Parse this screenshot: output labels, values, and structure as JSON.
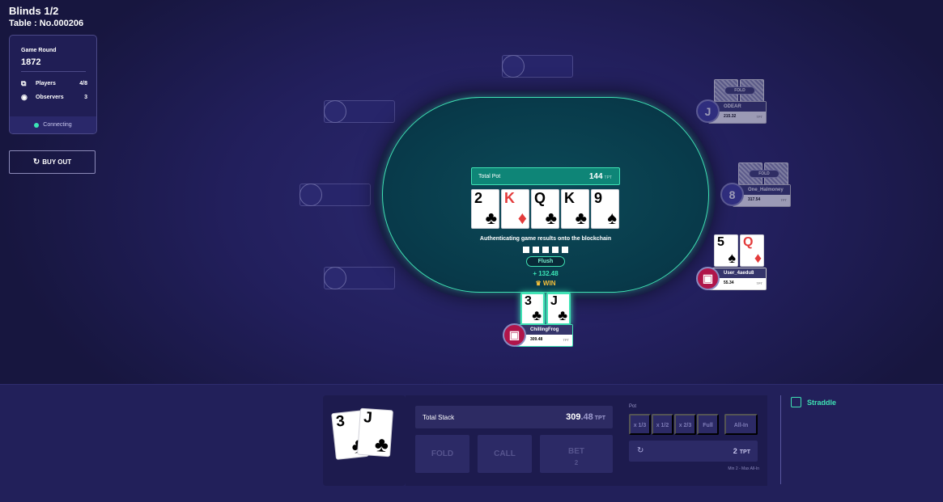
{
  "header": {
    "title": "Blinds 1/2",
    "table": "Table : No.000206"
  },
  "info": {
    "round_label": "Game Round",
    "round_value": "1872",
    "players_label": "Players",
    "players_value": "4/8",
    "observers_label": "Observers",
    "observers_value": "3",
    "status": "Connecting"
  },
  "buyout_label": "BUY OUT",
  "pot": {
    "label": "Total Pot",
    "value": "144",
    "unit": "TPT"
  },
  "community_cards": [
    {
      "rank": "2",
      "suit": "♣",
      "color": "black"
    },
    {
      "rank": "K",
      "suit": "♦",
      "color": "red"
    },
    {
      "rank": "Q",
      "suit": "♣",
      "color": "black"
    },
    {
      "rank": "K",
      "suit": "♣",
      "color": "black"
    },
    {
      "rank": "9",
      "suit": "♠",
      "color": "black"
    }
  ],
  "status_text": "Authenticating game results onto the blockchain",
  "hand_name": "Flush",
  "gain": "+ 132.48",
  "win_label": "WIN",
  "players": {
    "odear": {
      "name": "ODEAR",
      "stack": "215.32",
      "unit": "TPT",
      "avatar": "J",
      "tag": "FOLD"
    },
    "one": {
      "name": "One_Halmoney",
      "stack": "317.54",
      "unit": "TPT",
      "avatar": "8",
      "tag": "FOLD"
    },
    "user": {
      "name": "User_4aedu8",
      "stack": "55.34",
      "unit": "TPT",
      "cards": [
        {
          "rank": "5",
          "suit": "♠",
          "color": "black"
        },
        {
          "rank": "Q",
          "suit": "♦",
          "color": "red"
        }
      ]
    },
    "me": {
      "name": "ChillingFrog",
      "stack": "309.48",
      "unit": "TPT",
      "cards": [
        {
          "rank": "3",
          "suit": "♣",
          "color": "black"
        },
        {
          "rank": "J",
          "suit": "♣",
          "color": "black"
        }
      ]
    }
  },
  "controls": {
    "stack_label": "Total Stack",
    "stack_int": "309",
    "stack_dec": ".48",
    "stack_unit": "TPT",
    "fold": "FOLD",
    "call": "CALL",
    "bet": "BET",
    "bet_amount": "2",
    "pot_label": "Pot",
    "fractions": [
      "x 1/3",
      "x 1/2",
      "x 2/3",
      "Full",
      "All-In"
    ],
    "amount": "2",
    "amount_unit": "TPT",
    "range": "Min 2 - Max All-In",
    "straddle": "Straddle"
  },
  "colors": {
    "accent": "#3fe2b4",
    "felt": "#083a4a",
    "win": "#f5c03a"
  }
}
